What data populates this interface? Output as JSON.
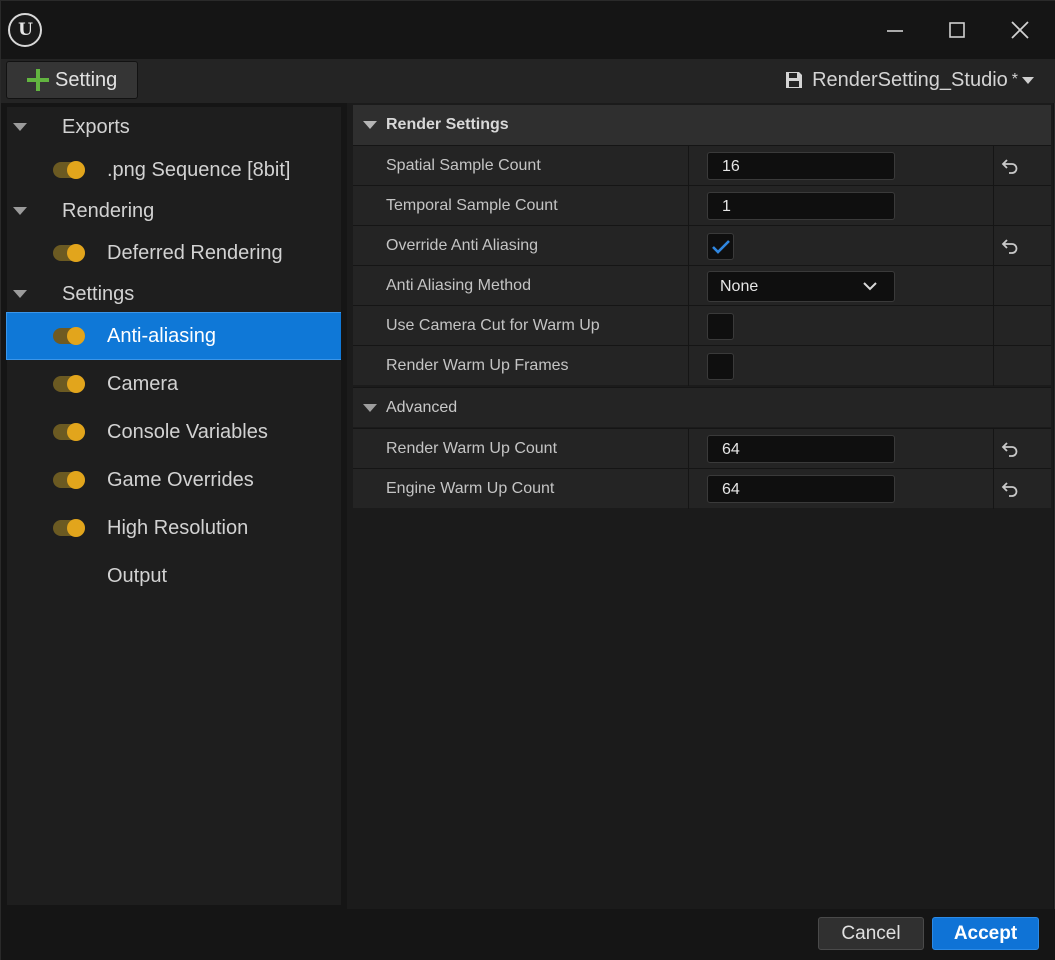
{
  "window": {
    "logo_text": "U",
    "controls": [
      "minimize",
      "maximize",
      "close"
    ]
  },
  "toolbar": {
    "add_setting_label": "Setting",
    "preset_name": "RenderSetting_Studio",
    "modified_marker": "*"
  },
  "sidebar": {
    "groups": [
      {
        "label": "Exports",
        "items": [
          {
            "label": ".png Sequence [8bit]",
            "enabled": true
          }
        ]
      },
      {
        "label": "Rendering",
        "items": [
          {
            "label": "Deferred Rendering",
            "enabled": true
          }
        ]
      },
      {
        "label": "Settings",
        "items": [
          {
            "label": "Anti-aliasing",
            "enabled": true,
            "selected": true
          },
          {
            "label": "Camera",
            "enabled": true
          },
          {
            "label": "Console Variables",
            "enabled": true
          },
          {
            "label": "Game Overrides",
            "enabled": true
          },
          {
            "label": "High Resolution",
            "enabled": true
          },
          {
            "label": "Output",
            "enabled": null
          }
        ]
      }
    ]
  },
  "details": {
    "section_title": "Render Settings",
    "props": [
      {
        "name": "Spatial Sample Count",
        "value": "16",
        "reset": true
      },
      {
        "name": "Temporal Sample Count",
        "value": "1",
        "reset": false
      },
      {
        "name": "Override Anti Aliasing",
        "checked": true,
        "reset": true
      },
      {
        "name": "Anti Aliasing Method",
        "value": "None",
        "reset": false
      },
      {
        "name": "Use Camera Cut for Warm Up",
        "checked": false,
        "reset": false
      },
      {
        "name": "Render Warm Up Frames",
        "checked": false,
        "reset": false
      }
    ],
    "advanced_title": "Advanced",
    "advanced_props": [
      {
        "name": "Render Warm Up Count",
        "value": "64",
        "reset": true
      },
      {
        "name": "Engine Warm Up Count",
        "value": "64",
        "reset": true
      }
    ]
  },
  "footer": {
    "cancel_label": "Cancel",
    "accept_label": "Accept"
  },
  "colors": {
    "accent": "#0f78d7",
    "toggle_on": "#e2a51c",
    "add_icon": "#62b540"
  }
}
